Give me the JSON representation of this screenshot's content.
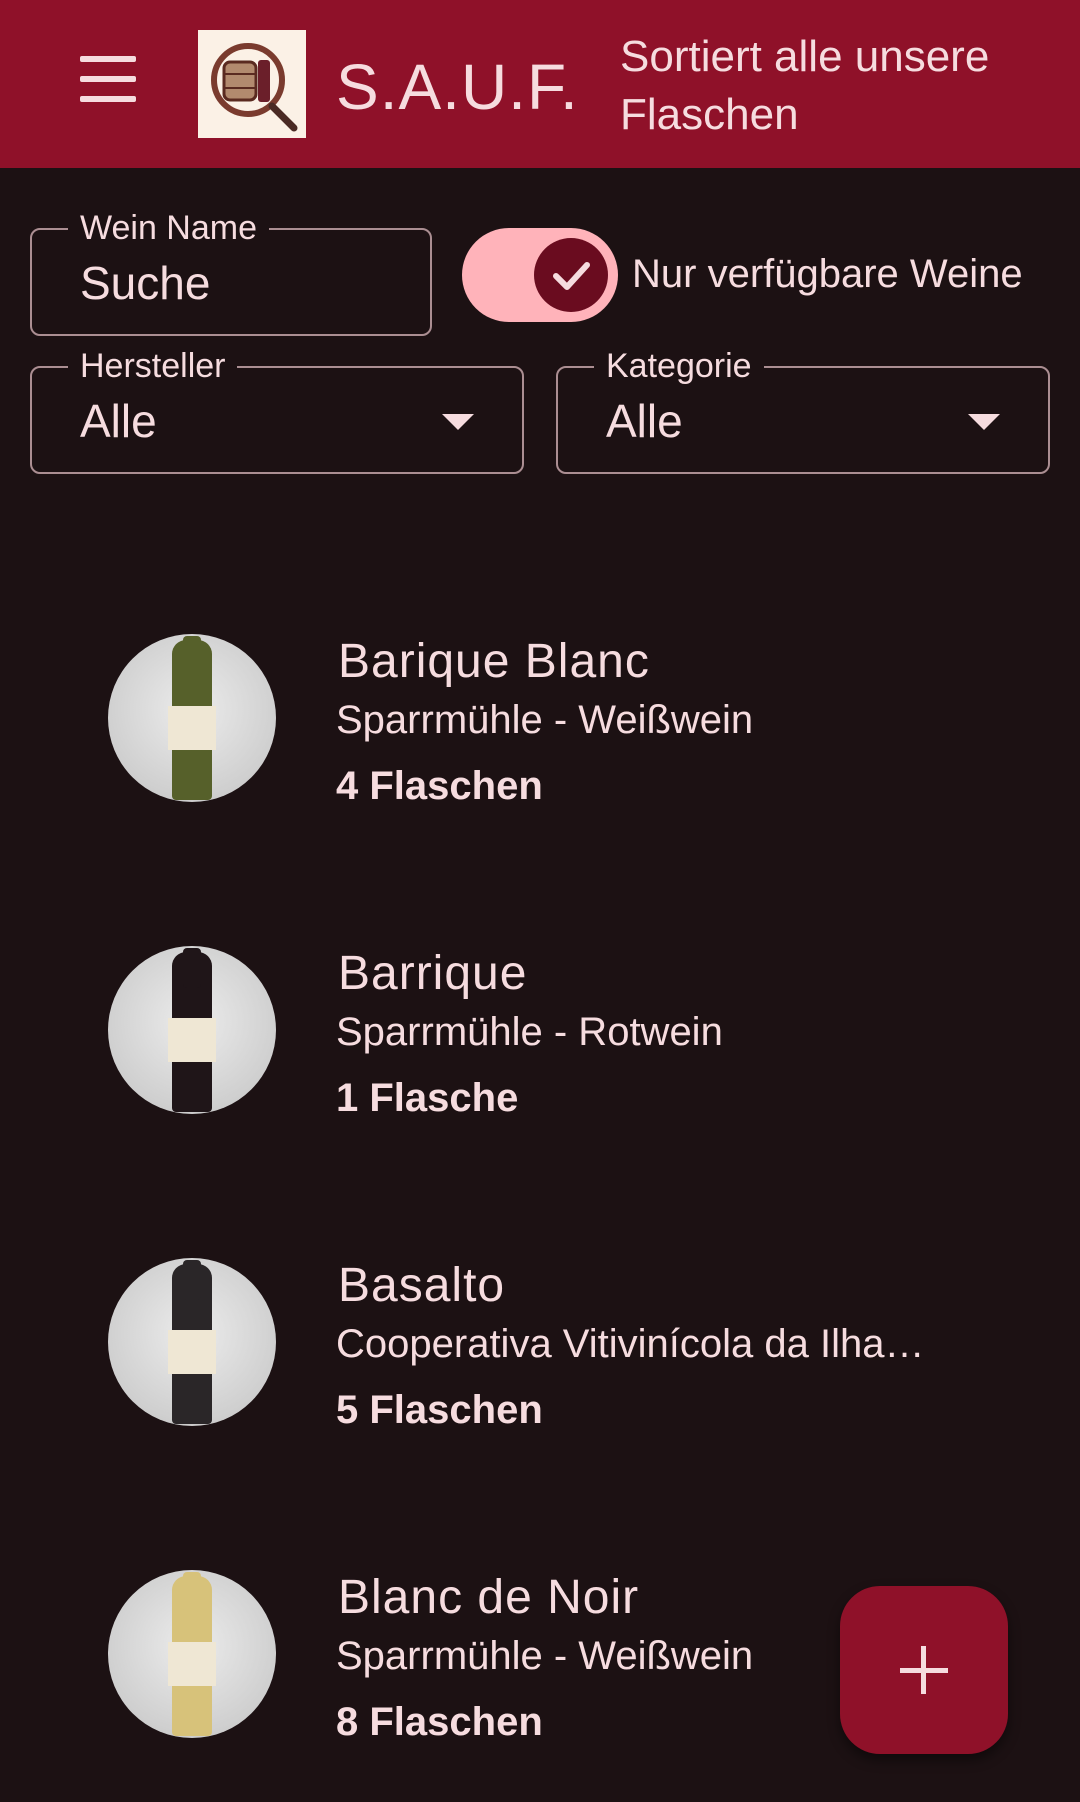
{
  "appbar": {
    "title": "S.A.U.F.",
    "subtitle": "Sortiert alle unsere Flaschen",
    "menu_icon": "menu-icon",
    "logo_icon": "barrel-magnifier-logo"
  },
  "filters": {
    "search": {
      "label": "Wein Name",
      "value": "Suche"
    },
    "available_toggle": {
      "label": "Nur verfügbare Weine",
      "checked": true,
      "icon": "check-icon"
    },
    "producer": {
      "label": "Hersteller",
      "value": "Alle",
      "icon": "dropdown-arrow-icon"
    },
    "category": {
      "label": "Kategorie",
      "value": "Alle",
      "icon": "dropdown-arrow-icon"
    }
  },
  "wines": [
    {
      "name": "Barique Blanc",
      "subtitle": "Sparrmühle - Weißwein",
      "count": "4 Flaschen",
      "bottle_color": "#56602a"
    },
    {
      "name": "Barrique",
      "subtitle": "Sparrmühle - Rotwein",
      "count": "1 Flasche",
      "bottle_color": "#1f1518"
    },
    {
      "name": "Basalto",
      "subtitle": "Cooperativa Vitivinícola da Ilha…",
      "count": "5 Flaschen",
      "bottle_color": "#2a2628"
    },
    {
      "name": "Blanc de Noir",
      "subtitle": "Sparrmühle - Weißwein",
      "count": "8 Flaschen",
      "bottle_color": "#d7c27a"
    }
  ],
  "fab": {
    "icon": "add-icon"
  },
  "colors": {
    "primary": "#8f1129",
    "background": "#1c1113",
    "on_surface": "#f6dcdf",
    "toggle_track": "#ffb3ba",
    "toggle_knob": "#6a0c1f"
  }
}
